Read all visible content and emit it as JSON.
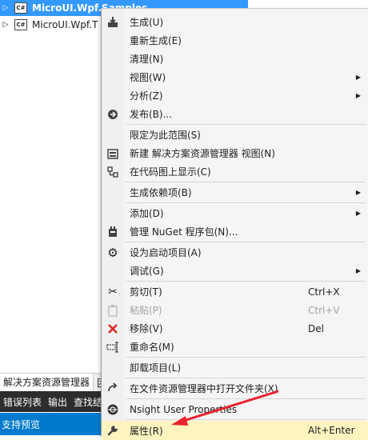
{
  "tree": [
    {
      "label": "MicroUI.Wpf.Samples",
      "selected": true
    },
    {
      "label": "MicroUI.Wpf.T",
      "selected": false
    }
  ],
  "tabs1": [
    "解决方案资源管理器",
    "团"
  ],
  "tabs2": [
    "错误列表",
    "输出",
    "查找结"
  ],
  "status": "支持预览",
  "menu": {
    "items": [
      {
        "label": "生成(U)",
        "icon": "build-icon"
      },
      {
        "label": "重新生成(E)"
      },
      {
        "label": "清理(N)"
      },
      {
        "label": "视图(W)",
        "submenu": true
      },
      {
        "label": "分析(Z)",
        "submenu": true
      },
      {
        "label": "发布(B)...",
        "icon": "publish-icon"
      },
      {
        "label": "限定为此范围(S)"
      },
      {
        "label": "新建 解决方案资源管理器 视图(N)",
        "icon": "new-view-icon"
      },
      {
        "label": "在代码图上显示(C)",
        "icon": "code-map-icon"
      },
      {
        "label": "生成依赖项(B)",
        "submenu": true
      },
      {
        "label": "添加(D)",
        "submenu": true
      },
      {
        "label": "管理 NuGet 程序包(N)...",
        "icon": "nuget-icon"
      },
      {
        "label": "设为启动项目(A)",
        "icon": "gear-icon"
      },
      {
        "label": "调试(G)",
        "submenu": true
      },
      {
        "label": "剪切(T)",
        "icon": "scissors-icon",
        "shortcut": "Ctrl+X"
      },
      {
        "label": "粘贴(P)",
        "icon": "paste-icon",
        "shortcut": "Ctrl+V",
        "disabled": true
      },
      {
        "label": "移除(V)",
        "icon": "remove-icon",
        "shortcut": "Del"
      },
      {
        "label": "重命名(M)",
        "icon": "rename-icon"
      },
      {
        "label": "卸载项目(L)"
      },
      {
        "label": "在文件资源管理器中打开文件夹(X)",
        "icon": "open-folder-icon"
      },
      {
        "label": "Nsight User Properties",
        "icon": "nsight-icon"
      },
      {
        "label": "属性(R)",
        "icon": "wrench-icon",
        "shortcut": "Alt+Enter",
        "highlighted": true
      }
    ]
  },
  "colors": {
    "selection": "#3399ff",
    "highlight": "#fdf4bf",
    "arrow": "#e8222e",
    "statusbar": "#007acc"
  }
}
